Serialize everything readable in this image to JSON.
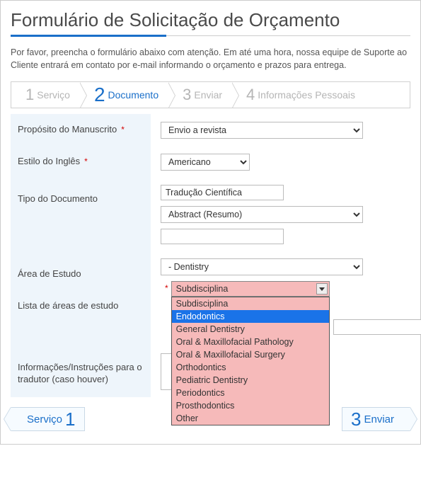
{
  "title": "Formulário de Solicitação de Orçamento",
  "intro": "Por favor, preencha o formulário abaixo com atenção. Em até uma hora, nossa equipe de Suporte ao Cliente entrará em contato por e-mail informando o orçamento e prazos para entrega.",
  "steps": [
    {
      "num": "1",
      "label": "Serviço"
    },
    {
      "num": "2",
      "label": "Documento"
    },
    {
      "num": "3",
      "label": "Enviar"
    },
    {
      "num": "4",
      "label": "Informações Pessoais"
    }
  ],
  "active_step": 1,
  "labels": {
    "purpose": "Propósito do Manuscrito",
    "english_style": "Estilo do Inglês",
    "doc_type": "Tipo do Documento",
    "study_area": "Área de Estudo",
    "study_area_list": "Lista de áreas de estudo",
    "instructions": "Informações/Instruções para o tradutor (caso houver)"
  },
  "values": {
    "purpose": "Envio a revista",
    "english_style": "Americano",
    "doc_type_text": "Tradução Científica",
    "doc_type_select": "Abstract (Resumo)",
    "doc_type_extra": "",
    "study_area_select": "- Dentistry",
    "subdiscipline_selected": "Subdisciplina",
    "instructions": ""
  },
  "subdiscipline_options": [
    "Subdisciplina",
    "Endodontics",
    "General Dentistry",
    "Oral & Maxillofacial Pathology",
    "Oral & Maxillofacial Surgery",
    "Orthodontics",
    "Pediatric Dentistry",
    "Periodontics",
    "Prosthodontics",
    "Other"
  ],
  "subdiscipline_highlight": 1,
  "nav": {
    "prev_num": "1",
    "prev_label": "Serviço",
    "next_num": "3",
    "next_label": "Enviar"
  }
}
